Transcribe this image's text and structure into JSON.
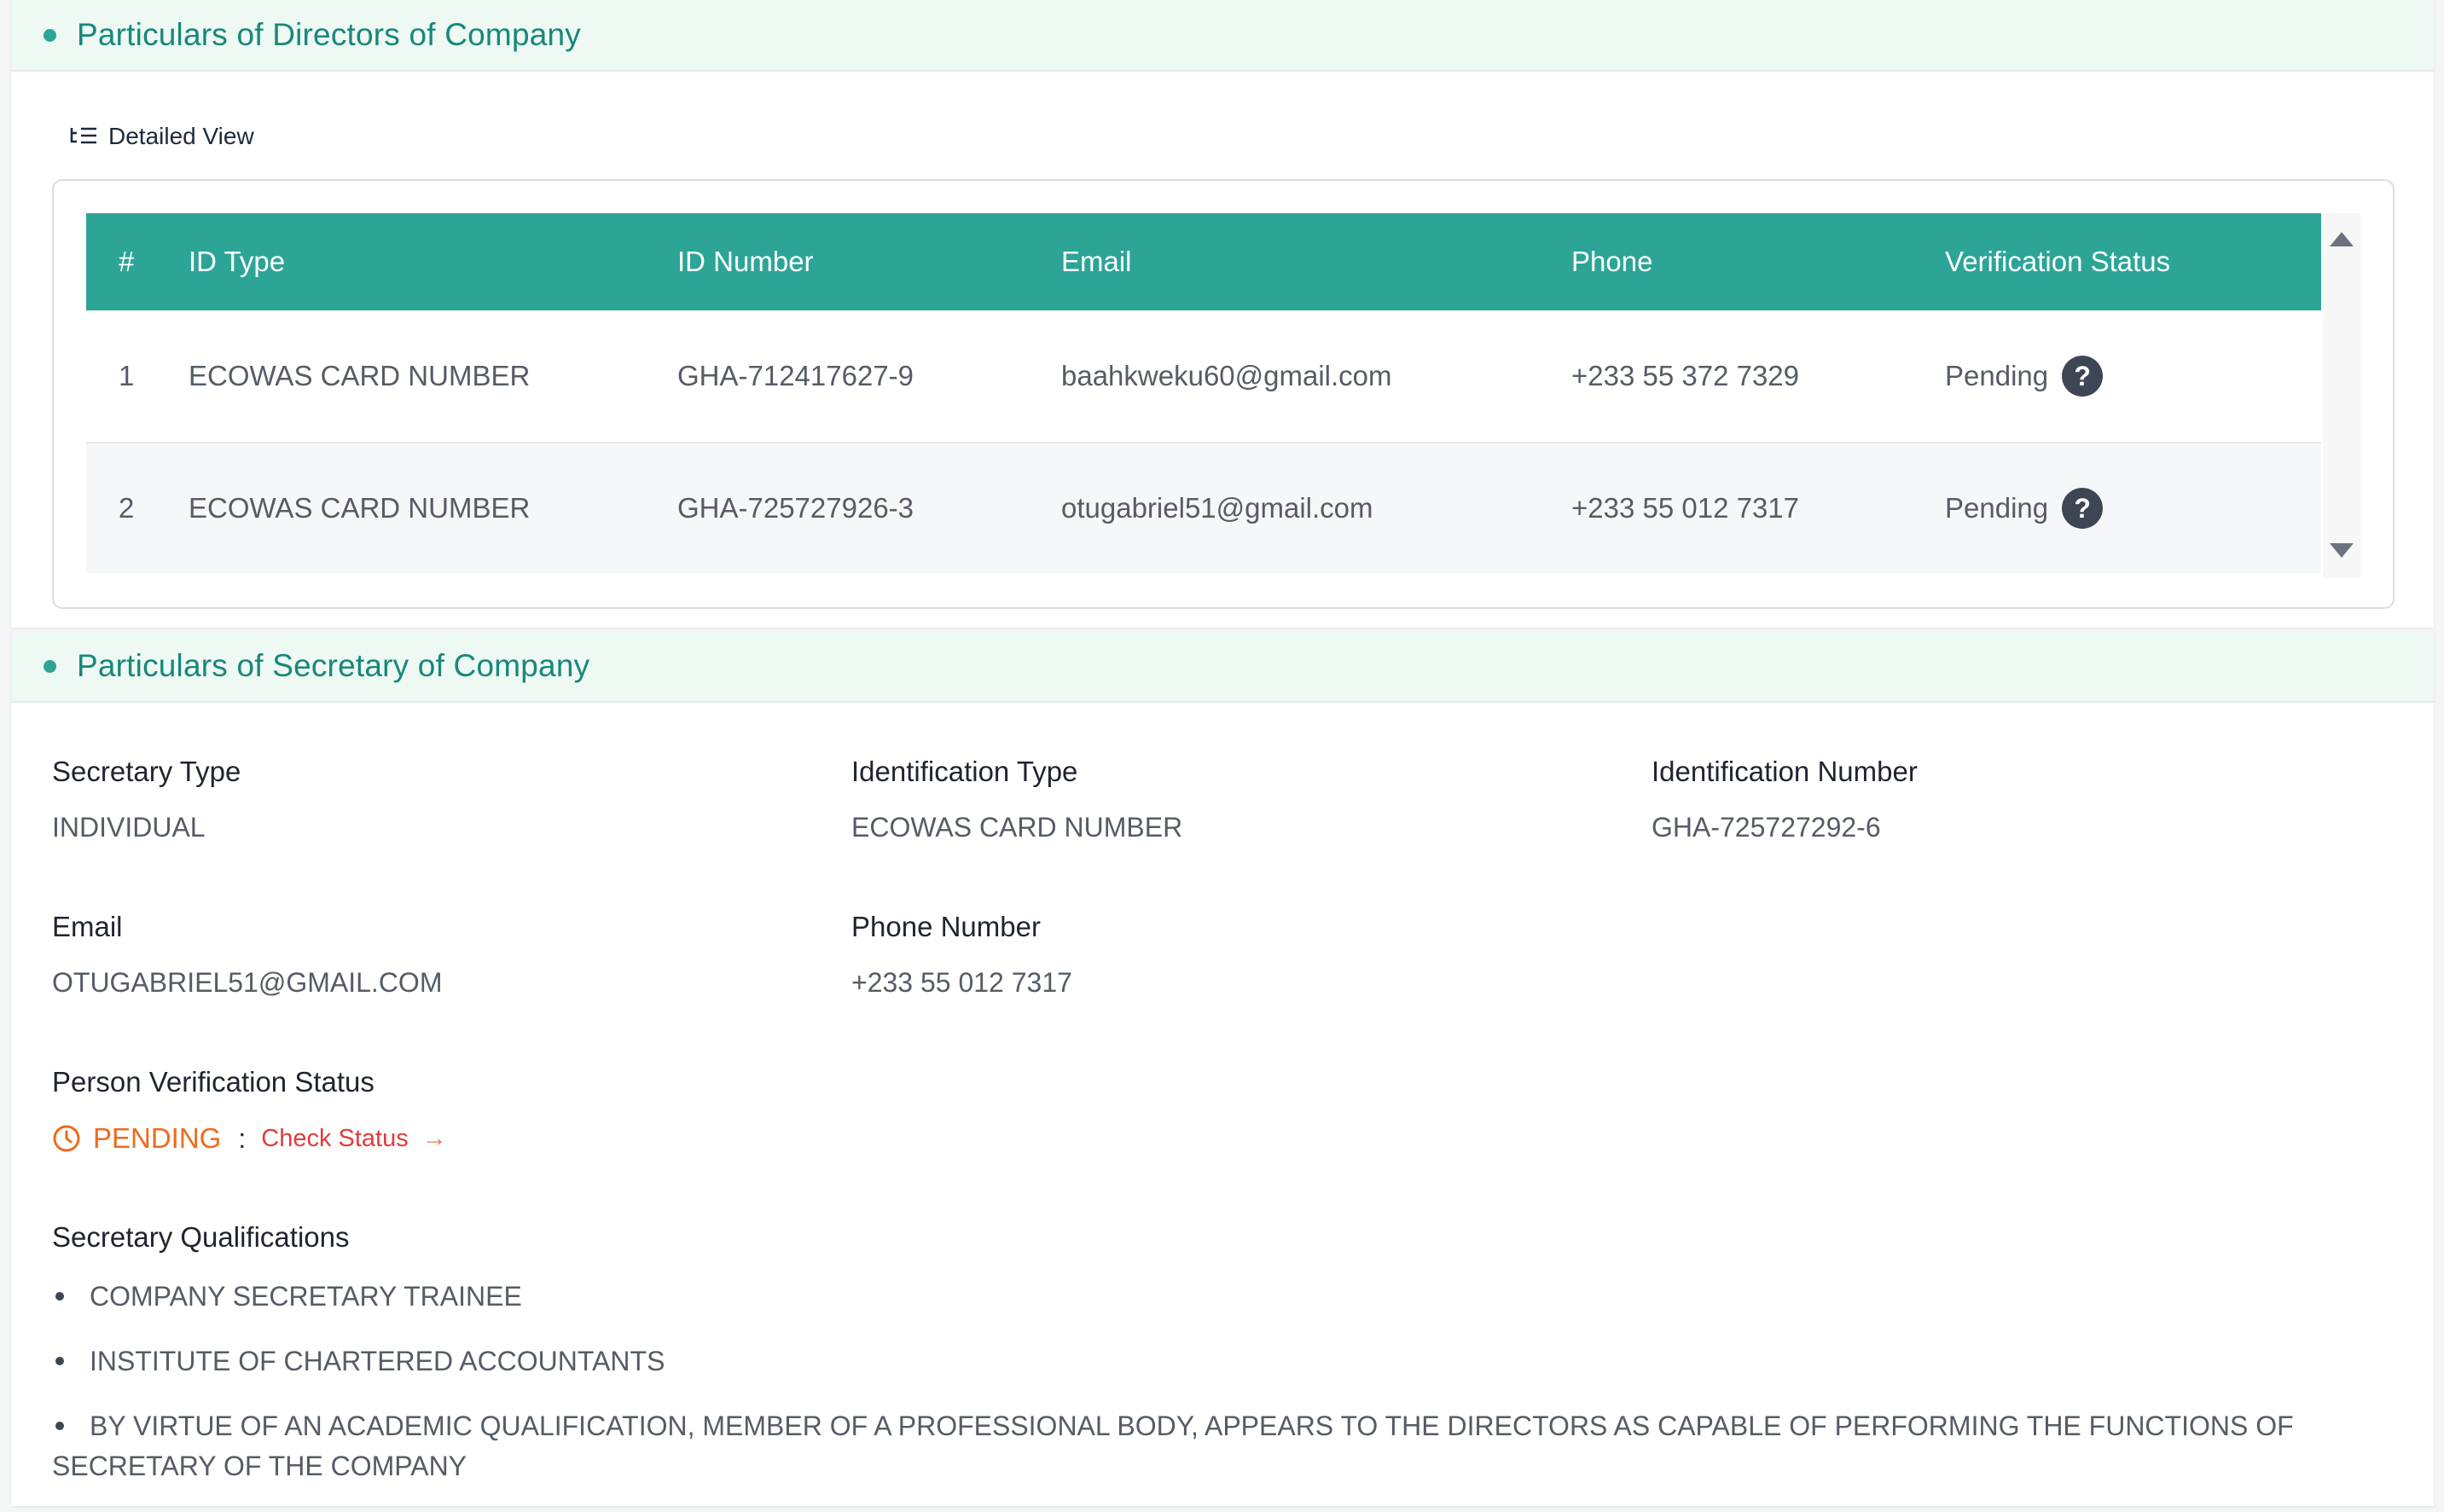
{
  "directors": {
    "title": "Particulars of Directors of Company",
    "detailed_view_label": "Detailed View",
    "columns": [
      "#",
      "ID Type",
      "ID Number",
      "Email",
      "Phone",
      "Verification Status"
    ],
    "rows": [
      {
        "num": "1",
        "id_type": "ECOWAS CARD NUMBER",
        "id_number": "GHA-712417627-9",
        "email": "baahkweku60@gmail.com",
        "phone": "+233 55 372 7329",
        "status": "Pending"
      },
      {
        "num": "2",
        "id_type": "ECOWAS CARD NUMBER",
        "id_number": "GHA-725727926-3",
        "email": "otugabriel51@gmail.com",
        "phone": "+233 55 012 7317",
        "status": "Pending"
      }
    ],
    "help_glyph": "?"
  },
  "secretary": {
    "title": "Particulars of Secretary of Company",
    "secretary_type_label": "Secretary Type",
    "secretary_type": "INDIVIDUAL",
    "id_type_label": "Identification Type",
    "id_type": "ECOWAS CARD NUMBER",
    "id_number_label": "Identification Number",
    "id_number": "GHA-725727292-6",
    "email_label": "Email",
    "email": "OTUGABRIEL51@GMAIL.COM",
    "phone_label": "Phone Number",
    "phone": "+233 55 012 7317",
    "verification_label": "Person Verification Status",
    "verification_status": "PENDING",
    "separator": ":",
    "check_status_label": "Check Status",
    "arrow_glyph": "→",
    "qualifications_label": "Secretary Qualifications",
    "qualifications": [
      "COMPANY SECRETARY TRAINEE",
      "INSTITUTE OF CHARTERED ACCOUNTANTS",
      "BY VIRTUE OF AN ACADEMIC QUALIFICATION, MEMBER OF A PROFESSIONAL BODY, APPEARS TO THE DIRECTORS AS CAPABLE OF PERFORMING THE FUNCTIONS OF SECRETARY OF THE COMPANY"
    ]
  },
  "colors": {
    "accent": "#2ca597",
    "header_bg": "#edf9f2",
    "title_text": "#18877b",
    "pending_orange": "#ed6b1f",
    "check_status_red": "#e23b3b"
  },
  "icons": [
    "list-tree-icon",
    "help-icon",
    "clock-icon",
    "arrow-right-icon",
    "scroll-up-arrow-icon",
    "scroll-down-arrow-icon"
  ]
}
